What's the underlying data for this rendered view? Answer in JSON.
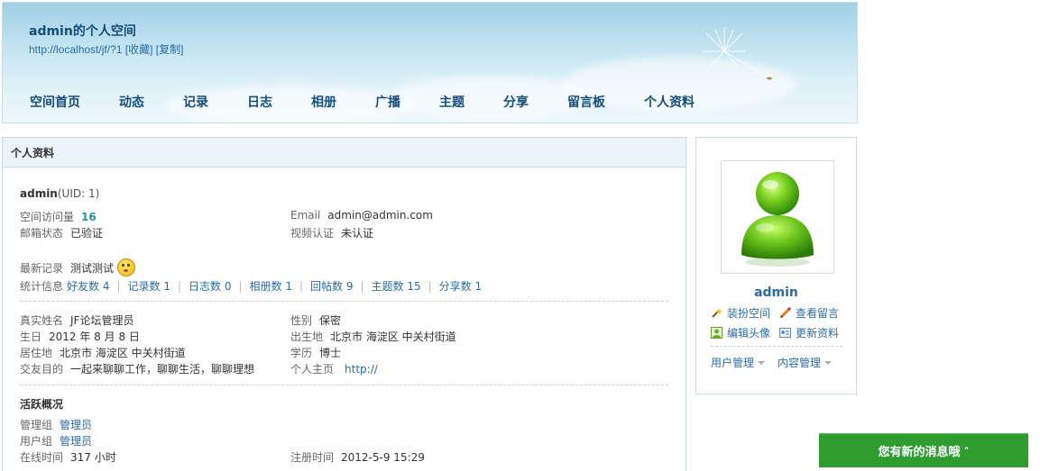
{
  "header": {
    "title": "admin的个人空间",
    "url": "http://localhost/jf/?1",
    "favorite": "[收藏]",
    "copy": "[复制]",
    "nav": [
      "空间首页",
      "动态",
      "记录",
      "日志",
      "相册",
      "广播",
      "主题",
      "分享",
      "留言板",
      "个人资料"
    ]
  },
  "main": {
    "heading": "个人资料",
    "user": {
      "name": "admin",
      "uid": "(UID: 1)"
    },
    "visits_label": "空间访问量",
    "visits": "16",
    "email_label": "Email",
    "email": "admin@admin.com",
    "mail_status_label": "邮箱状态",
    "mail_status": "已验证",
    "video_label": "视频认证",
    "video": "未认证",
    "latest_label": "最新记录",
    "latest": "测试测试",
    "stats_label": "统计信息",
    "stats": [
      "好友数 4",
      "记录数 1",
      "日志数 0",
      "相册数 1",
      "回帖数 9",
      "主题数 15",
      "分享数 1"
    ],
    "realname_label": "真实姓名",
    "realname": "JF论坛管理员",
    "gender_label": "性别",
    "gender": "保密",
    "birthday_label": "生日",
    "birthday": "2012 年 8 月 8 日",
    "birthplace_label": "出生地",
    "birthplace": "北京市 海淀区 中关村街道",
    "residence_label": "居住地",
    "residence": "北京市 海淀区 中关村街道",
    "education_label": "学历",
    "education": "博士",
    "purpose_label": "交友目的",
    "purpose": "一起来聊聊工作，聊聊生活，聊聊理想",
    "homepage_label": "个人主页",
    "homepage": "http://",
    "activity_title": "活跃概况",
    "admin_group_label": "管理组",
    "admin_group": "管理员",
    "user_group_label": "用户组",
    "user_group": "管理员",
    "online_label": "在线时间",
    "online": "317 小时",
    "register_label": "注册时间",
    "register": "2012-5-9 15:29"
  },
  "side": {
    "username": "admin",
    "actions": [
      "装扮空间",
      "查看留言",
      "编辑头像",
      "更新资料"
    ],
    "menus": [
      "用户管理",
      "内容管理"
    ]
  },
  "notification": {
    "text": "您有新的消息哦"
  },
  "colors": {
    "link": "#2b6ca3",
    "nav": "#154d7a",
    "notify": "#2f9c2f"
  }
}
